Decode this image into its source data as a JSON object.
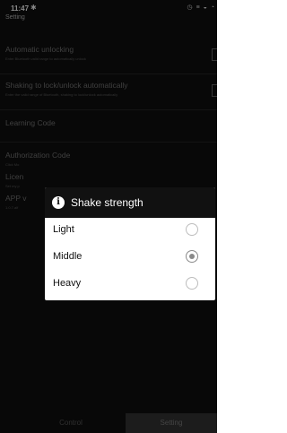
{
  "status_bar": {
    "time": "11:47",
    "bluetooth_glyph": "✱",
    "icons_text": "◷ ≡ ◒ ◔"
  },
  "page": {
    "title": "Setting"
  },
  "settings": [
    {
      "title": "Automatic unlocking",
      "subtitle": "Enter Bluetooth valid range to automatically unlock",
      "has_toggle": true
    },
    {
      "title": "Shaking to lock/unlock automatically",
      "subtitle": "Enter the valid range of Bluetooth, shaking to lock/unlock automatically",
      "has_toggle": true
    },
    {
      "title": "Learning Code",
      "subtitle": ""
    },
    {
      "title": "Authorization Code",
      "subtitle": "Click Mo"
    },
    {
      "title": "Licen",
      "subtitle": "Set my p"
    },
    {
      "title": "APP v",
      "subtitle": "1.0.7.alf"
    }
  ],
  "dialog": {
    "title": "Shake strength",
    "icon": "info-icon",
    "options": [
      {
        "label": "Light",
        "selected": false
      },
      {
        "label": "Middle",
        "selected": true
      },
      {
        "label": "Heavy",
        "selected": false
      }
    ]
  },
  "tabs": {
    "control": "Control",
    "setting": "Setting"
  },
  "colors": {
    "background": "#0d0d0d",
    "dialog_header": "#111111",
    "dialog_body": "#ffffff",
    "active_tab": "#2b2b2b"
  }
}
